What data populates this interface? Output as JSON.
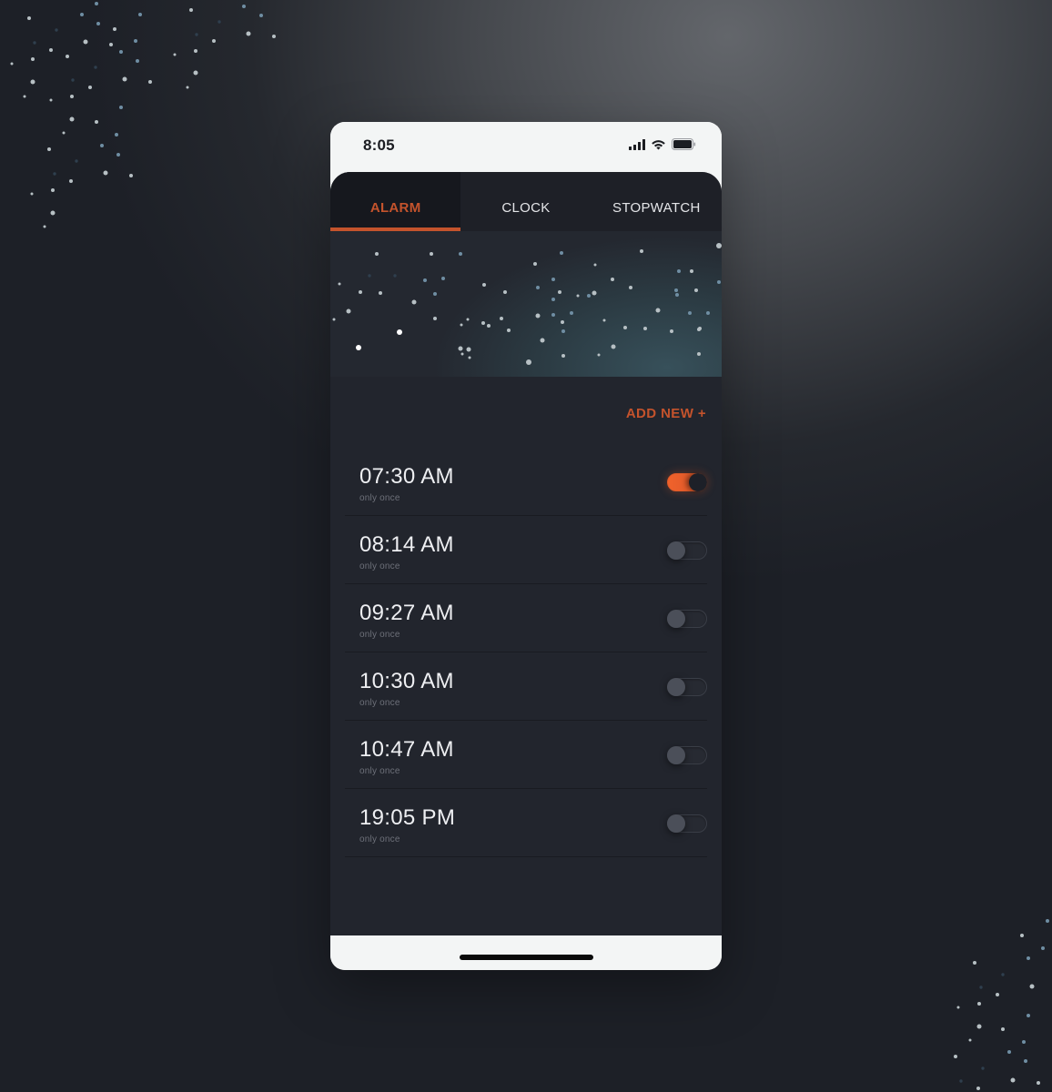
{
  "status_bar": {
    "time": "8:05",
    "icons": [
      "cellular-signal-icon",
      "wifi-icon",
      "battery-icon"
    ]
  },
  "tabs": [
    {
      "label": "ALARM",
      "active": true
    },
    {
      "label": "CLOCK",
      "active": false
    },
    {
      "label": "STOPWATCH",
      "active": false
    }
  ],
  "add_new_label": "ADD NEW +",
  "alarms": [
    {
      "time": "07:30 AM",
      "repeat": "only once",
      "enabled": true
    },
    {
      "time": "08:14 AM",
      "repeat": "only once",
      "enabled": false
    },
    {
      "time": "09:27 AM",
      "repeat": "only once",
      "enabled": false
    },
    {
      "time": "10:30 AM",
      "repeat": "only once",
      "enabled": false
    },
    {
      "time": "10:47 AM",
      "repeat": "only once",
      "enabled": false
    },
    {
      "time": "19:05 PM",
      "repeat": "only once",
      "enabled": false
    }
  ],
  "colors": {
    "accent": "#c4532c",
    "toggle_on": "#f0622b",
    "app_background": "#22252d",
    "tab_bar": "#1e2027",
    "active_tab": "#16181e"
  }
}
